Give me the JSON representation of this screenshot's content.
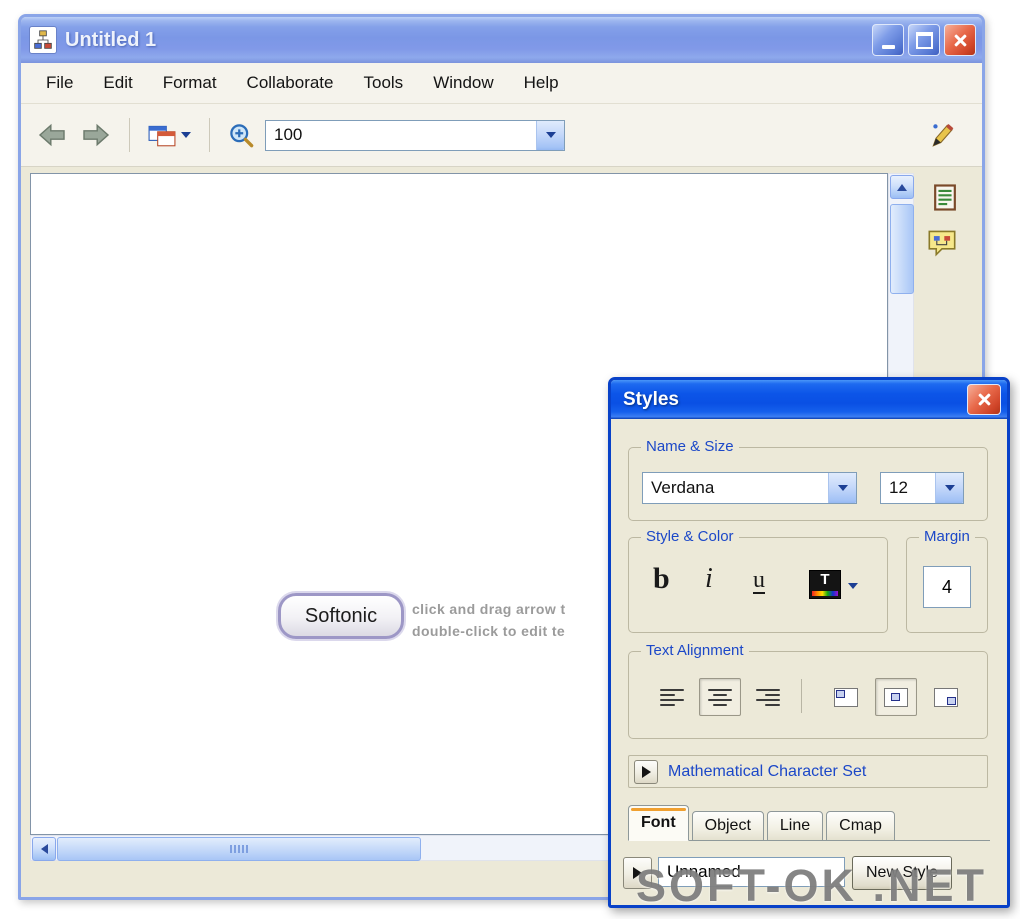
{
  "main_window": {
    "title": "Untitled 1",
    "menu": {
      "items": [
        "File",
        "Edit",
        "Format",
        "Collaborate",
        "Tools",
        "Window",
        "Help"
      ]
    },
    "toolbar": {
      "zoom_value": "100"
    },
    "canvas": {
      "node_label": "Softonic",
      "hint_line1": "click and drag arrow t",
      "hint_line2": "double-click to edit te"
    }
  },
  "styles_dialog": {
    "title": "Styles",
    "name_size": {
      "label": "Name & Size",
      "font_value": "Verdana",
      "size_value": "12"
    },
    "style_color": {
      "label": "Style & Color",
      "bold": "b",
      "italic": "i",
      "underline": "u",
      "color_letter": "T"
    },
    "margin": {
      "label": "Margin",
      "value": "4"
    },
    "text_alignment": {
      "label": "Text Alignment"
    },
    "math_section": {
      "label": "Mathematical Character Set"
    },
    "tabs": [
      "Font",
      "Object",
      "Line",
      "Cmap"
    ],
    "footer": {
      "style_name": "Unnamed",
      "new_style_button": "New Style"
    }
  },
  "watermark": "SOFT-OK .NET",
  "colors": {
    "active_titlebar": "#0a50e4",
    "inactive_titlebar": "#8aa5e8",
    "window_bg": "#ece9d8",
    "group_label": "#1c48c8",
    "close_red": "#cf4428",
    "watermark_gray": "#747474"
  }
}
